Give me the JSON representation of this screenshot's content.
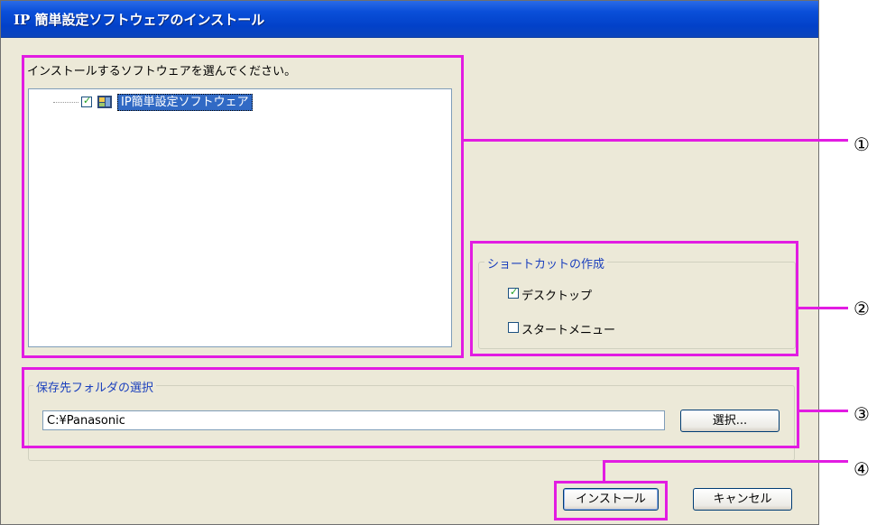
{
  "window": {
    "title": "IP 簡単設定ソフトウェアのインストール"
  },
  "software": {
    "prompt": "インストールするソフトウェアを選んでください。",
    "tree_item": {
      "label": "IP簡単設定ソフトウェア",
      "checked": true
    }
  },
  "shortcut": {
    "legend": "ショートカットの作成",
    "desktop_label": "デスクトップ",
    "desktop_checked": true,
    "startmenu_label": "スタートメニュー",
    "startmenu_checked": false
  },
  "folder": {
    "legend": "保存先フォルダの選択",
    "path": "C:¥Panasonic",
    "browse_label": "選択..."
  },
  "buttons": {
    "install_label": "インストール",
    "cancel_label": "キャンセル"
  },
  "callouts": [
    "①",
    "②",
    "③",
    "④"
  ],
  "colors": {
    "highlight": "#e21ce2",
    "titlebar": "#0a4fd9",
    "legend": "#1a3fbd"
  }
}
